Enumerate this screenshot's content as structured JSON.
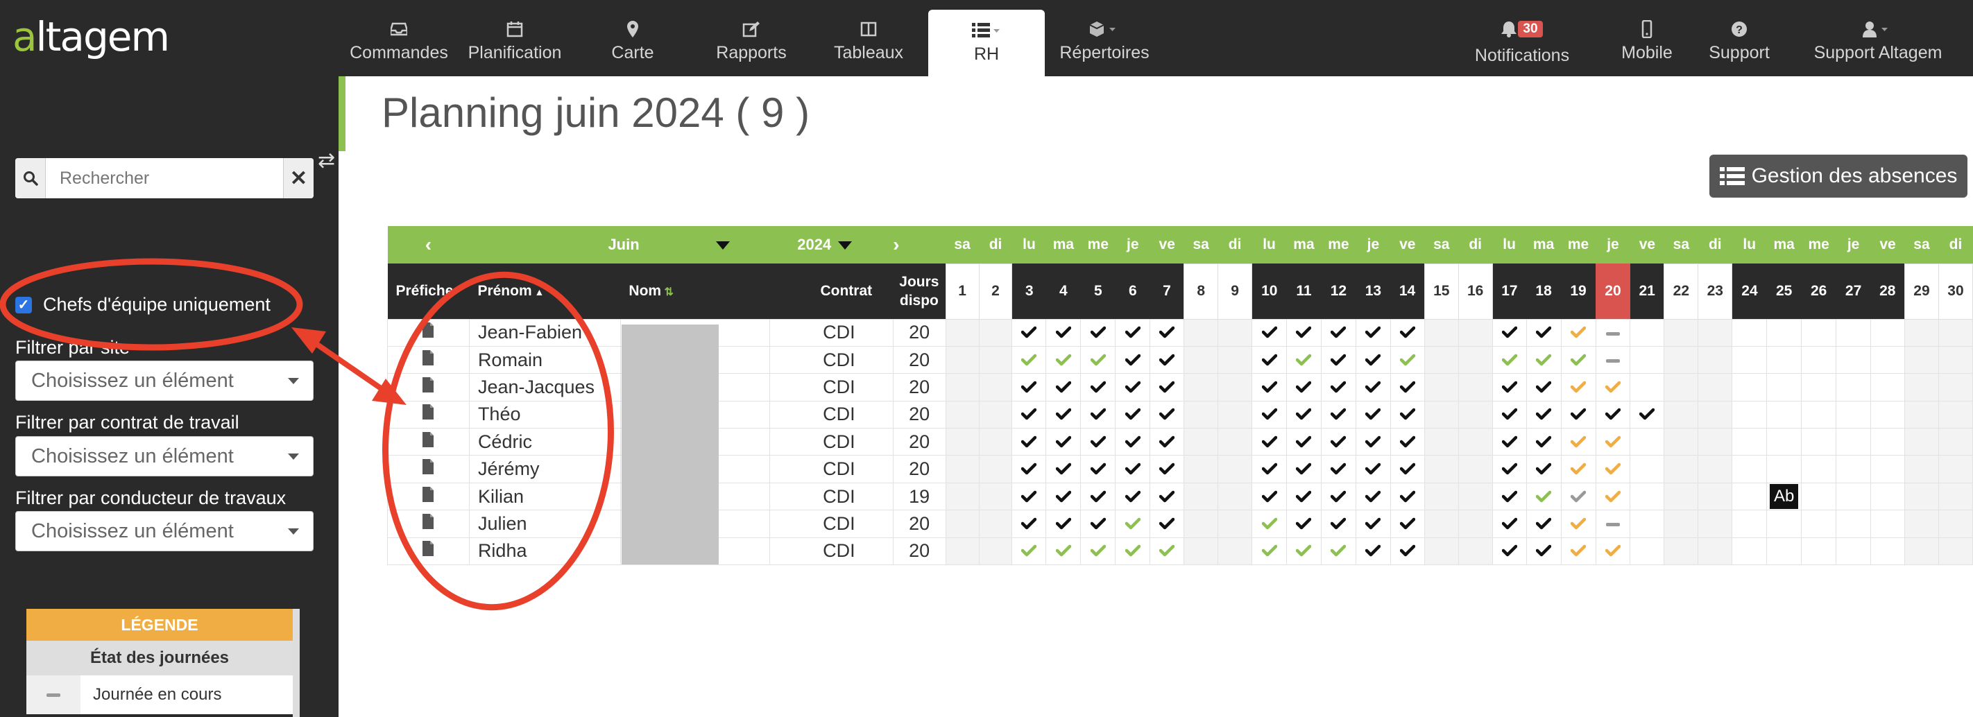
{
  "app": {
    "logo": "altagem"
  },
  "nav": [
    {
      "key": "commandes",
      "label": "Commandes",
      "icon": "inbox-icon"
    },
    {
      "key": "planification",
      "label": "Planification",
      "icon": "calendar-icon"
    },
    {
      "key": "carte",
      "label": "Carte",
      "icon": "map-marker-icon"
    },
    {
      "key": "rapports",
      "label": "Rapports",
      "icon": "edit-icon"
    },
    {
      "key": "tableaux",
      "label": "Tableaux",
      "icon": "columns-icon"
    },
    {
      "key": "rh",
      "label": "RH",
      "icon": "list-icon",
      "active": true
    },
    {
      "key": "repertoires",
      "label": "Répertoires",
      "icon": "cube-icon"
    }
  ],
  "nav_right": [
    {
      "key": "notifications",
      "label": "Notifications",
      "icon": "bell-icon",
      "badge": "30"
    },
    {
      "key": "mobile",
      "label": "Mobile",
      "icon": "mobile-icon"
    },
    {
      "key": "support",
      "label": "Support",
      "icon": "question-icon"
    },
    {
      "key": "user",
      "label": "Support Altagem",
      "icon": "user-icon"
    }
  ],
  "sidebar": {
    "search_placeholder": "Rechercher",
    "chefs_label": "Chefs d'équipe uniquement",
    "chefs_checked": true,
    "filters": [
      {
        "label": "Filtrer par site",
        "value": "Choisissez un élément"
      },
      {
        "label": "Filtrer par contrat de travail",
        "value": "Choisissez un élément"
      },
      {
        "label": "Filtrer par conducteur de travaux",
        "value": "Choisissez un élément"
      }
    ],
    "legend": {
      "title": "LÉGENDE",
      "section": "État des journées",
      "rows": [
        {
          "label": "Journée en cours"
        }
      ]
    }
  },
  "page": {
    "title": "Planning juin 2024 ( 9 )",
    "absences_button": "Gestion des absences"
  },
  "planning": {
    "month": "Juin",
    "year": "2024",
    "headers": {
      "prefiche": "Préfiche",
      "prenom": "Prénom",
      "nom": "Nom",
      "contrat": "Contrat",
      "jours": "Jours dispo"
    },
    "today": 20,
    "days": [
      {
        "d": "1",
        "wd": "sa"
      },
      {
        "d": "2",
        "wd": "di"
      },
      {
        "d": "3",
        "wd": "lu"
      },
      {
        "d": "4",
        "wd": "ma"
      },
      {
        "d": "5",
        "wd": "me"
      },
      {
        "d": "6",
        "wd": "je"
      },
      {
        "d": "7",
        "wd": "ve"
      },
      {
        "d": "8",
        "wd": "sa"
      },
      {
        "d": "9",
        "wd": "di"
      },
      {
        "d": "10",
        "wd": "lu"
      },
      {
        "d": "11",
        "wd": "ma"
      },
      {
        "d": "12",
        "wd": "me"
      },
      {
        "d": "13",
        "wd": "je"
      },
      {
        "d": "14",
        "wd": "ve"
      },
      {
        "d": "15",
        "wd": "sa"
      },
      {
        "d": "16",
        "wd": "di"
      },
      {
        "d": "17",
        "wd": "lu"
      },
      {
        "d": "18",
        "wd": "ma"
      },
      {
        "d": "19",
        "wd": "me"
      },
      {
        "d": "20",
        "wd": "je"
      },
      {
        "d": "21",
        "wd": "ve"
      },
      {
        "d": "22",
        "wd": "sa"
      },
      {
        "d": "23",
        "wd": "di"
      },
      {
        "d": "24",
        "wd": "lu"
      },
      {
        "d": "25",
        "wd": "ma"
      },
      {
        "d": "26",
        "wd": "me"
      },
      {
        "d": "27",
        "wd": "je"
      },
      {
        "d": "28",
        "wd": "ve"
      },
      {
        "d": "29",
        "wd": "sa"
      },
      {
        "d": "30",
        "wd": "di"
      }
    ],
    "status_legend": {
      "k": "black check",
      "g": "green check",
      "o": "orange check",
      "r": "grey check",
      "d": "grey dash",
      "a": "absence Ab"
    },
    "colors": {
      "k": "#111111",
      "g": "#8cc152",
      "o": "#f0ad44",
      "r": "#999999"
    },
    "absence_label": "Ab",
    "rows": [
      {
        "prenom": "Jean-Fabien",
        "contrat": "CDI",
        "jours": "20",
        "s": "..kkkkk..kkkkk..kkod.........."
      },
      {
        "prenom": "Romain",
        "contrat": "CDI",
        "jours": "20",
        "s": "..gggkk..kgkkg..gggd.........."
      },
      {
        "prenom": "Jean-Jacques",
        "contrat": "CDI",
        "jours": "20",
        "s": "..kkkkk..kkkkk..kkoo.........."
      },
      {
        "prenom": "Théo",
        "contrat": "CDI",
        "jours": "20",
        "s": "..kkkkk..kkkkk..kkkkk........."
      },
      {
        "prenom": "Cédric",
        "contrat": "CDI",
        "jours": "20",
        "s": "..kkkkk..kkkkk..kkoo.........."
      },
      {
        "prenom": "Jérémy",
        "contrat": "CDI",
        "jours": "20",
        "s": "..kkkkk..kkkkk..kkoo.........."
      },
      {
        "prenom": "Kilian",
        "contrat": "CDI",
        "jours": "19",
        "s": "..kkkkk..kkkkk..kgro....a....."
      },
      {
        "prenom": "Julien",
        "contrat": "CDI",
        "jours": "20",
        "s": "..kkkgk..gkkkk..kkod.........."
      },
      {
        "prenom": "Ridha",
        "contrat": "CDI",
        "jours": "20",
        "s": "..ggggg..gggkk..kkoo.........."
      }
    ]
  }
}
